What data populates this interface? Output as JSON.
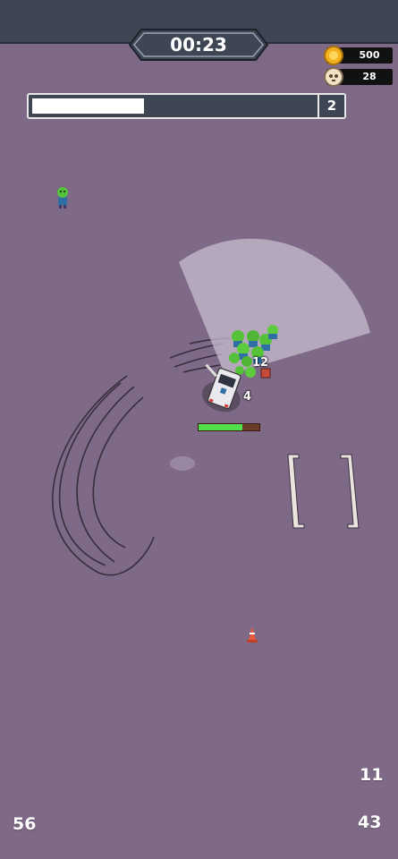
{
  "hud": {
    "timer": "00:23",
    "coins": "500",
    "kills": "28",
    "wave_level": "2",
    "wave_progress": 0.39,
    "counter_left_bottom": "56",
    "counter_right_upper": "11",
    "counter_right_bottom": "43"
  },
  "player": {
    "horde_count": "12",
    "vehicle_level": "4",
    "health": 0.72
  },
  "icons": {
    "coin": "coin-icon",
    "skull": "skull-icon"
  },
  "colors": {
    "ground": "#7e6a86",
    "hud_bar": "#3e4654",
    "health_green": "#52e04a",
    "zombie_green": "#55c23a",
    "coin_gold": "#f2b21f"
  }
}
